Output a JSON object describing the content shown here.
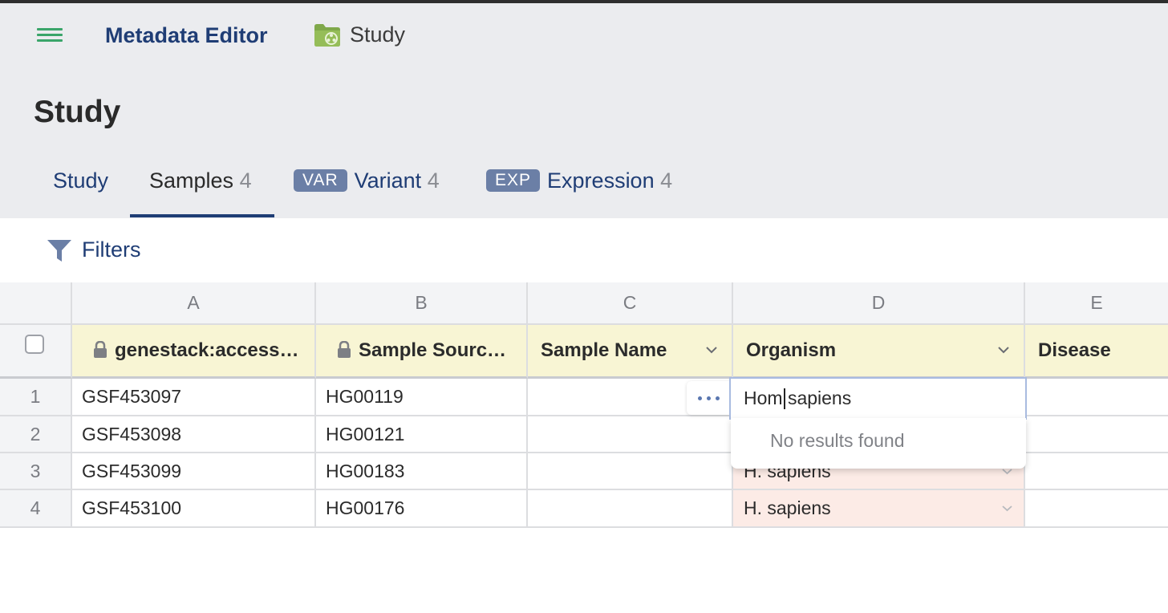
{
  "app": {
    "title": "Metadata Editor",
    "breadcrumb": "Study",
    "page_title": "Study"
  },
  "tabs": [
    {
      "label": "Study",
      "badge": "",
      "count": ""
    },
    {
      "label": "Samples",
      "badge": "",
      "count": "4"
    },
    {
      "label": "Variant",
      "badge": "VAR",
      "count": "4"
    },
    {
      "label": "Expression",
      "badge": "EXP",
      "count": "4"
    }
  ],
  "filters": {
    "label": "Filters"
  },
  "grid": {
    "column_letters": [
      "A",
      "B",
      "C",
      "D",
      "E"
    ],
    "headers": [
      "genestack:access…",
      "Sample Sourc…",
      "Sample Name",
      "Organism",
      "Disease"
    ],
    "rows": [
      {
        "num": "1",
        "accession": "GSF453097",
        "source": "HG00119",
        "name": "",
        "organism": ""
      },
      {
        "num": "2",
        "accession": "GSF453098",
        "source": "HG00121",
        "name": "",
        "organism": ""
      },
      {
        "num": "3",
        "accession": "GSF453099",
        "source": "HG00183",
        "name": "",
        "organism": "H. sapiens"
      },
      {
        "num": "4",
        "accession": "GSF453100",
        "source": "HG00176",
        "name": "",
        "organism": "H. sapiens"
      }
    ]
  },
  "editor": {
    "value": "Hom sapiens",
    "no_results": "No results found"
  },
  "colors": {
    "brand_navy": "#1f3d75",
    "hamburger_green": "#3aa56a",
    "header_bg": "#ebecef",
    "column_header_bg": "#f8f5d4",
    "invalid_cell_bg": "#fcebe6",
    "badge_bg": "#6b7fa6"
  },
  "icons": [
    "hamburger-menu-icon",
    "folder-icon",
    "filter-icon",
    "lock-icon",
    "chevron-down-icon",
    "more-horizontal-icon",
    "checkbox-icon"
  ]
}
